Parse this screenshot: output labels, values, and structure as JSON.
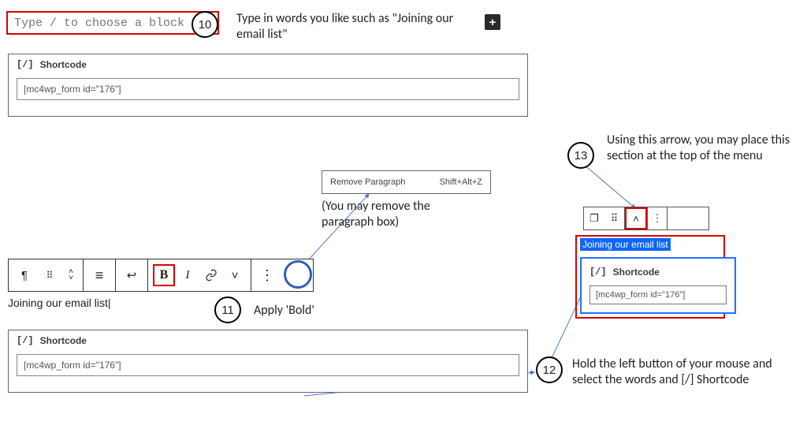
{
  "step10": {
    "placeholder": "Type / to choose a block",
    "number": "10",
    "annotation": "Type in words you like such as \"Joining our email list\""
  },
  "plus_icon": "+",
  "shortcode_panel_top": {
    "icon": "[/]",
    "label": "Shortcode",
    "value": "[mc4wp_form id=\"176\"]"
  },
  "toolbar": {
    "pilcrow": "¶",
    "drag_handle": "⠿",
    "move_up": "˄",
    "move_down": "˅",
    "align": "≡",
    "link_break": "↩",
    "bold": "B",
    "italic": "I",
    "link": "⌀",
    "chevron_down": "˅",
    "more": "⋮"
  },
  "step11": {
    "number": "11",
    "typed_text": "Joining our email list",
    "cursor": "|",
    "annotation": "Apply 'Bold'"
  },
  "remove_popover": {
    "label": "Remove Paragraph",
    "shortcut": "Shift+Alt+Z"
  },
  "remove_note": "(You may remove the paragraph box)",
  "shortcode_panel_bottom": {
    "icon": "[/]",
    "label": "Shortcode",
    "value": "[mc4wp_form id=\"176\"]"
  },
  "step12": {
    "number": "12",
    "annotation": "Hold the left button of your mouse and select the words and [/] Shortcode",
    "mini_toolbar": {
      "copy": "❐",
      "drag": "⠿",
      "up": "˄",
      "more": "⋮"
    },
    "highlighted_text": "Joining our email list",
    "panel": {
      "icon": "[/]",
      "label": "Shortcode",
      "value": "[mc4wp_form id=\"176\"]"
    }
  },
  "step13": {
    "number": "13",
    "annotation": "Using this arrow, you may place this section at the top of the menu"
  }
}
